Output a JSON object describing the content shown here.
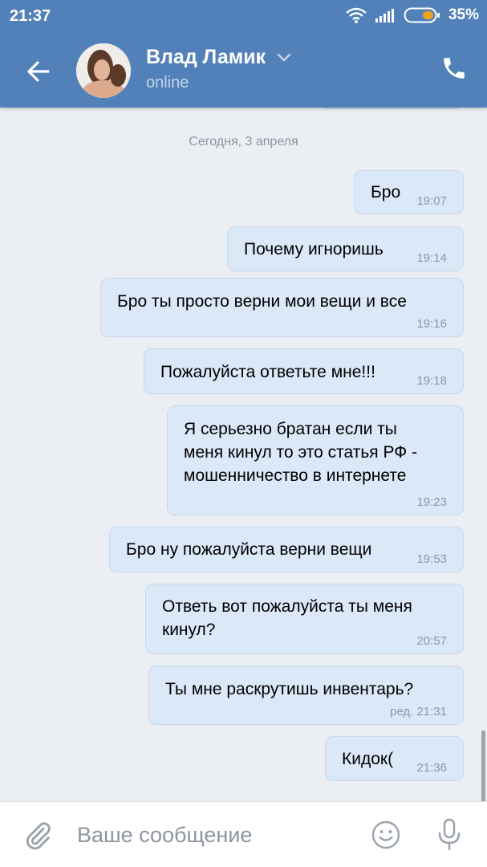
{
  "status_bar": {
    "time": "21:37",
    "battery_percent": "35%"
  },
  "header": {
    "contact_name": "Влад Ламик",
    "contact_status": "online"
  },
  "chat": {
    "date_separator": "Сегодня, 3 апреля",
    "messages": [
      {
        "text": "Бро",
        "time": "19:07"
      },
      {
        "text": "Почему игноришь",
        "time": "19:14"
      },
      {
        "text": "Бро ты просто верни мои вещи и все",
        "time": "19:16"
      },
      {
        "text": "Пожалуйста ответьте мне!!!",
        "time": "19:18"
      },
      {
        "text": "Я серьезно братан если ты\nменя кинул то это статья РФ -\nмошенничество в интернете",
        "time": "19:23"
      },
      {
        "text": "Бро ну пожалуйста верни вещи",
        "time": "19:53"
      },
      {
        "text": "Ответь вот пожалуйста ты меня\nкинул?",
        "time": "20:57"
      },
      {
        "text": "Ты мне раскрутишь инвентарь?",
        "time": "ред. 21:31"
      },
      {
        "text": "Кидок(",
        "time": "21:36"
      }
    ]
  },
  "input": {
    "placeholder": "Ваше сообщение"
  },
  "icons": {
    "back": "arrow-left-icon",
    "chevron": "chevron-down-icon",
    "call": "phone-icon",
    "attach": "paperclip-icon",
    "emoji": "smile-icon",
    "mic": "microphone-icon"
  },
  "colors": {
    "accent": "#5181b8",
    "bubble": "#dbe8f7",
    "background": "#ebeef2"
  }
}
